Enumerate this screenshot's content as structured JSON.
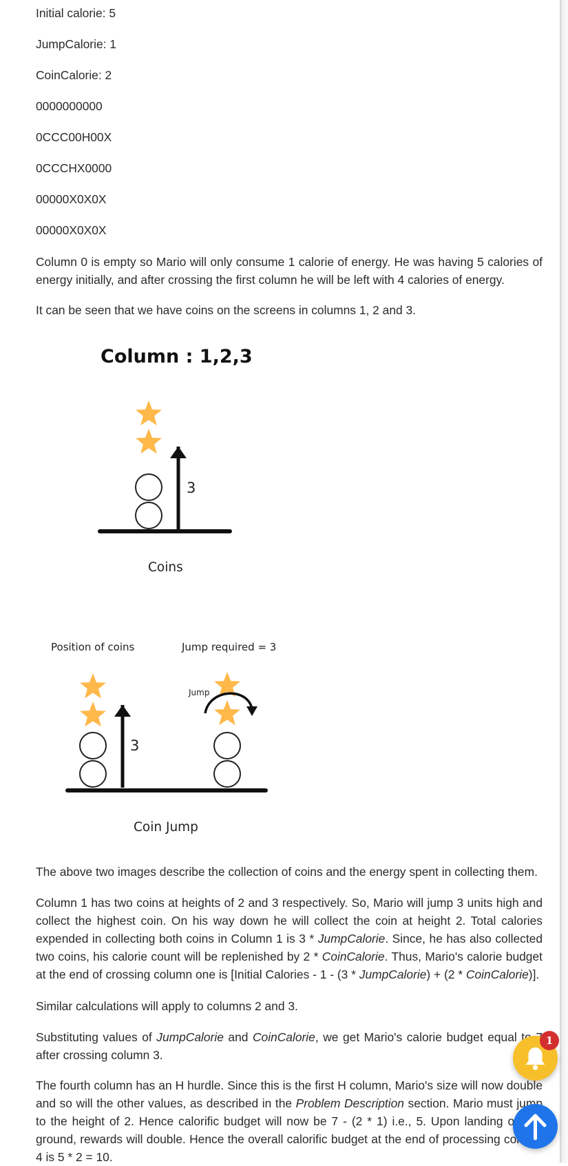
{
  "lines": [
    "Initial calorie: 5",
    "JumpCalorie: 1",
    "CoinCalorie: 2",
    "0000000000",
    "0CCC00H00X",
    "0CCCHX0000",
    "00000X0X0X",
    "00000X0X0X"
  ],
  "p_column0": "Column 0 is empty so Mario will only consume 1 calorie of energy. He was having 5 calories of energy initially, and after crossing the first column he will be left with 4 calories of energy.",
  "p_coins": "It can be seen that we have coins on the screens in columns 1, 2 and 3.",
  "figure1": {
    "title": "Column : 1,2,3",
    "height_label": "3",
    "caption": "Coins"
  },
  "figure2": {
    "label_left": "Position of coins",
    "label_right": "Jump required = 3",
    "height_label": "3",
    "jump_label": "Jump",
    "caption": "Coin Jump"
  },
  "p_above": "The above two images describe the collection of coins and the energy spent in collecting them.",
  "p_col1": {
    "t1": "Column 1 has two coins at heights of 2 and 3 respectively. So, Mario will jump 3 units high and collect the highest coin. On his way down he will collect the coin at height 2. Total calories expended in collecting both coins in Column 1 is 3 * ",
    "e1": "JumpCalorie",
    "t2": ". Since, he has also collected two coins, his calorie count will be replenished by 2 * ",
    "e2": "CoinCalorie",
    "t3": ". Thus, Mario's calorie budget at the end of crossing column one is [Initial Calories - 1 - (3 * ",
    "e3": "JumpCalorie",
    "t4": ") + (2 * ",
    "e4": "CoinCalorie",
    "t5": ")]."
  },
  "p_similar": "Similar calculations will apply to columns 2 and 3.",
  "p_subst": {
    "t1": "Substituting values of ",
    "e1": "JumpCalorie",
    "t2": " and ",
    "e2": "CoinCalorie",
    "t3": ", we get Mario's calorie budget equal to 7 after crossing column 3."
  },
  "p_fourth": {
    "t1": "The fourth column has an H hurdle. Since this is the first H column, Mario's size will now double and so will the other values, as described in the ",
    "e1": "Problem Description",
    "t2": " section. Mario must jump to the height of 2. Hence calorific budget will now be 7 - (2 * 1) i.e., 5. Upon landing on the ground, rewards will double. Hence the overall calorific budget at the end of processing column 4 is 5 * 2 = 10."
  },
  "notification_count": "1",
  "icons": {
    "bell": "bell-icon",
    "up": "arrow-up-icon"
  },
  "colors": {
    "star": "#FFB84A",
    "bell_fab": "#F7C02B",
    "up_fab": "#1F74EA",
    "badge": "#D32F2F"
  }
}
